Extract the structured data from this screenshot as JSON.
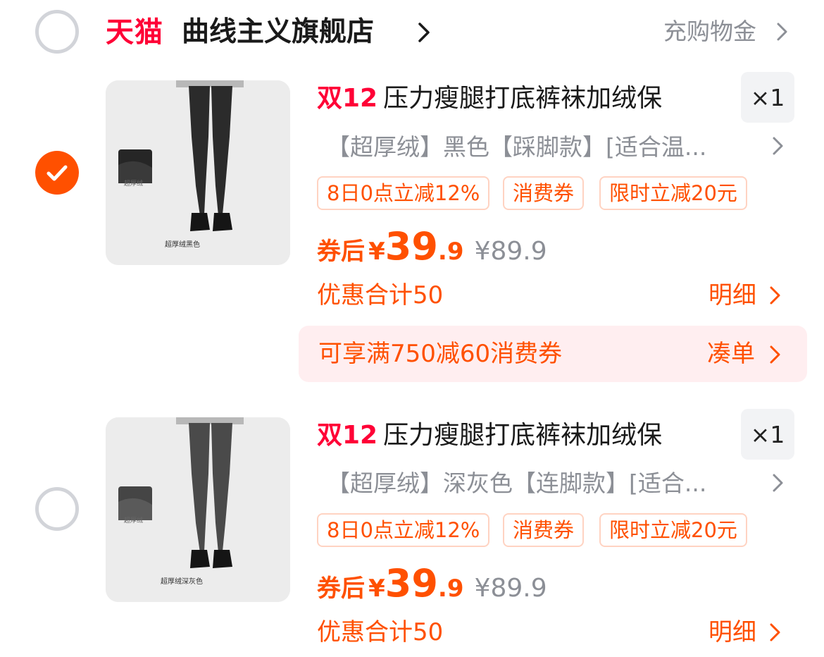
{
  "store": {
    "brand_logo": "天猫",
    "name": "曲线主义旗舰店",
    "recharge_label": "充购物金"
  },
  "items": [
    {
      "selected": true,
      "promo_tag": "双12",
      "title": "压力瘦腿打底裤袜加绒保",
      "quantity": "×1",
      "sku": "【超厚绒】黑色【踩脚款】[适合温...",
      "tags": [
        "8日0点立减12%",
        "消费券",
        "限时立减20元"
      ],
      "price_label": "券后",
      "price_currency": "¥",
      "price_int": "39",
      "price_dec": ".9",
      "original_price": "¥89.9",
      "discount_total": "优惠合计50",
      "detail_label": "明细",
      "thumb_badge": "超厚绒",
      "thumb_caption": "超厚绒黑色",
      "leg_color": "#2b2b2b"
    },
    {
      "selected": false,
      "promo_tag": "双12",
      "title": "压力瘦腿打底裤袜加绒保",
      "quantity": "×1",
      "sku": "【超厚绒】深灰色【连脚款】[适合...",
      "tags": [
        "8日0点立减12%",
        "消费券",
        "限时立减20元"
      ],
      "price_label": "券后",
      "price_currency": "¥",
      "price_int": "39",
      "price_dec": ".9",
      "original_price": "¥89.9",
      "discount_total": "优惠合计50",
      "detail_label": "明细",
      "thumb_badge": "超厚绒",
      "thumb_caption": "超厚绒深灰色",
      "leg_color": "#4a4a4a"
    }
  ],
  "coupon_bar": {
    "text": "可享满750减60消费券",
    "action": "凑单"
  },
  "icons": {
    "store_select": "radio-unchecked-icon",
    "item_check": "checkmark-icon",
    "chevron": "chevron-right-icon"
  },
  "colors": {
    "tmall_red": "#ff0036",
    "accent_orange": "#ff5000",
    "muted_gray": "#8c8f96",
    "coupon_bg": "#ffeef0"
  }
}
